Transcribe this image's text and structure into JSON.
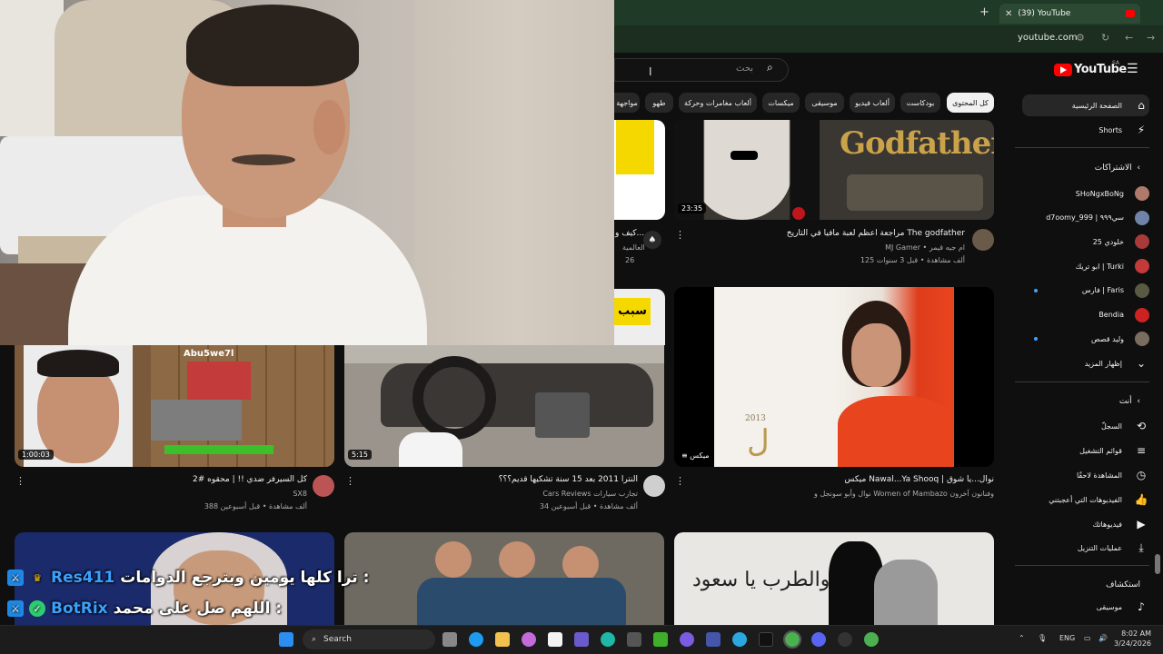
{
  "browser": {
    "tab_title": "(39) YouTube",
    "url": "youtube.com"
  },
  "youtube": {
    "logo_text": "YouTube",
    "logo_region": "SA",
    "search_placeholder": "بحث",
    "chips": [
      "كل المحتوى",
      "بودكاست",
      "ألعاب فيديو",
      "موسيقى",
      "ميكسات",
      "ألعاب مغامرات وحركة",
      "طهو",
      "مواجهة"
    ],
    "sidebar": {
      "home": "الصفحة الرئيسية",
      "shorts": "Shorts",
      "subs_header": "الاشتراكات",
      "subscriptions": [
        {
          "name": "SHoNgxBoNg",
          "color": "#b07a6a",
          "dot": false
        },
        {
          "name": "d7oomy_999 | سي٩٩٩",
          "color": "#6f84a8",
          "dot": false
        },
        {
          "name": "خلودي 25",
          "color": "#a83a3a",
          "dot": false
        },
        {
          "name": "ابو تريك | Turki",
          "color": "#c23a3a",
          "dot": false
        },
        {
          "name": "فارس | Faris",
          "color": "#5a5a44",
          "dot": true
        },
        {
          "name": "Bendia",
          "color": "#cc2222",
          "dot": false
        },
        {
          "name": "وليد قصص",
          "color": "#7a6d60",
          "dot": true
        }
      ],
      "show_more": "إظهار المزيد",
      "you_header": "أنت",
      "you_items": [
        "السجلّ",
        "قوائم التشغيل",
        "المشاهدة لاحقًا",
        "الفيديوهات التي أعجبتني",
        "فيديوهاتك",
        "عمليات التنزيل"
      ],
      "explore_header": "استكشاف",
      "explore_items": [
        "موسيقى"
      ]
    },
    "videos": [
      {
        "title": "مراجعة اعظم لعبة مافيا في التاريخ The godfather",
        "channel": "MJ Gamer • ام جيه قيمر",
        "meta": "125 ألف مشاهدة • قبل 3 سنوات",
        "duration": "23:35",
        "thumb_text": "Godfather"
      },
      {
        "title": "ميكس Nawal...Ya Shooq | نوال...يا شوق",
        "channel": "نوال وأبو سونجل و Women of Mambazo وفنانون آخرون",
        "meta": "",
        "duration": "ميكس",
        "thumb_text": "2013"
      },
      {
        "title": "النترا 2011 بعد 15 سنة تشكيها قديم؟؟؟",
        "channel": "Cars Reviews تجارب سيارات",
        "meta": "34 ألف مشاهدة • قبل أسبوعين",
        "duration": "5:15",
        "thumb_text": ""
      },
      {
        "title": "كل السيرفر ضدي !! | محقوه #2",
        "channel": "SX8",
        "meta": "388 ألف مشاهدة • قبل أسبوعين",
        "duration": "1:00:03",
        "thumb_text": "Abu5we7l"
      },
      {
        "title": "كيف و...",
        "channel": "العالمية",
        "meta": "26",
        "duration": "",
        "thumb_text": "سبب"
      }
    ],
    "bottom_thumb_text": "ليل السعد والطرب يا سعود"
  },
  "chat": [
    {
      "user": "Res411",
      "message": "ترا كلها يومين وبترجع الدوامات :"
    },
    {
      "user": "BotRix",
      "message": "اللهم صل على محمد :"
    }
  ],
  "taskbar": {
    "search_label": "Search",
    "lang": "ENG",
    "time": "8:02 AM",
    "date": "3/24/2026"
  },
  "colors": {
    "yt_red": "#ff0000",
    "link_blue": "#3ea6ff",
    "chat_user": "#3aa0ff"
  }
}
